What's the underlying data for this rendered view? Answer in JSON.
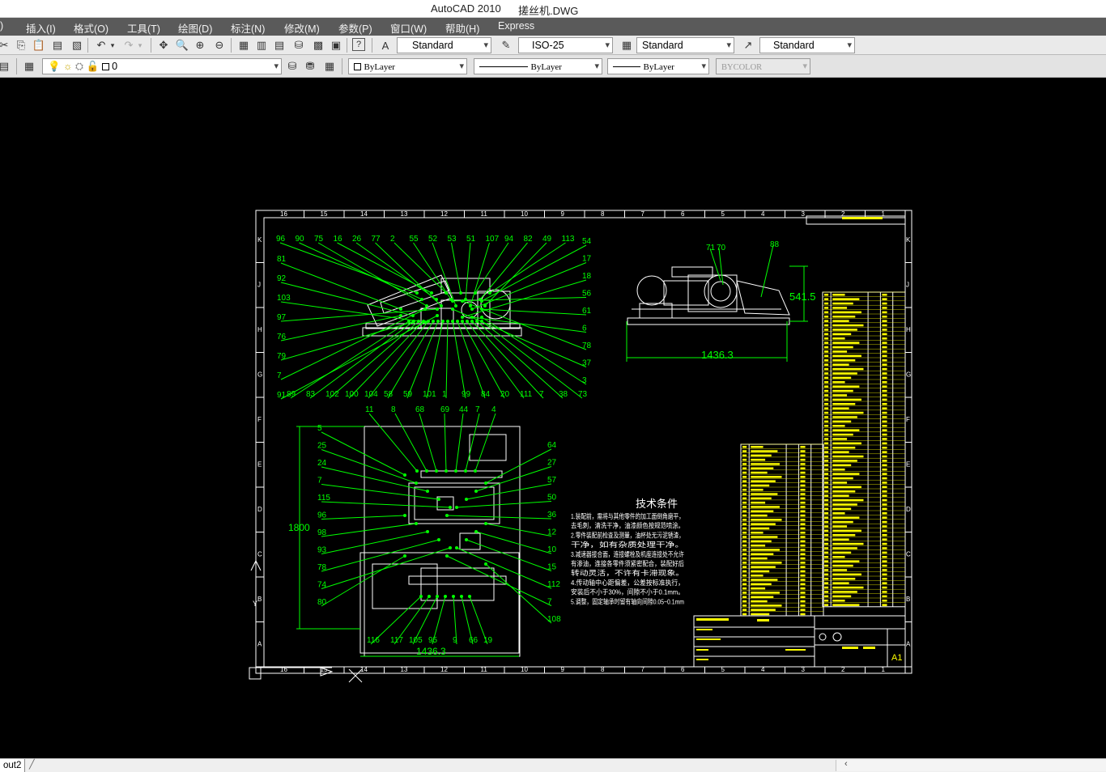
{
  "window": {
    "app_title": "AutoCAD 2010",
    "file_title": "搓丝机.DWG"
  },
  "menu": {
    "items": [
      ")",
      "插入(I)",
      "格式(O)",
      "工具(T)",
      "绘图(D)",
      "标注(N)",
      "修改(M)",
      "参数(P)",
      "窗口(W)",
      "帮助(H)",
      "Express"
    ]
  },
  "toolbar_styles": {
    "text_style": "Standard",
    "dim_style": "ISO-25",
    "table_style": "Standard",
    "mleader_style": "Standard"
  },
  "toolbar_layers": {
    "current_layer": "0",
    "color": "ByLayer",
    "linetype": "ByLayer",
    "lineweight": "ByLayer",
    "plotstyle": "BYCOLOR"
  },
  "status": {
    "layout_tab": "out2"
  },
  "colors": {
    "accent_lines": "#00ff00",
    "table_yellow": "#ffff00",
    "frame_white": "#ffffff",
    "menu_bg": "#5a5a5a"
  },
  "drawing": {
    "balloons_top_left": [
      "96",
      "90",
      "75",
      "16",
      "26",
      "77",
      "2",
      "55",
      "52",
      "53",
      "51",
      "107",
      "94",
      "82",
      "49",
      "113"
    ],
    "balloons_left": [
      "81",
      "92",
      "103",
      "97",
      "76",
      "79",
      "7",
      "91"
    ],
    "balloons_right": [
      "54",
      "17",
      "18",
      "56",
      "61",
      "6",
      "78",
      "37",
      "3"
    ],
    "balloons_bottom": [
      "89",
      "83",
      "102",
      "100",
      "104",
      "58",
      "59",
      "101",
      "1",
      "99",
      "84",
      "20",
      "111",
      "7",
      "38",
      "73"
    ],
    "side_view_labels": [
      "71",
      "70",
      "88"
    ],
    "dim_height_side": "541.5",
    "dim_width_side": "1436.3",
    "plan_labels_top": [
      "11",
      "8",
      "68",
      "69",
      "44",
      "7",
      "4"
    ],
    "plan_labels_left": [
      "5",
      "25",
      "24",
      "7",
      "115",
      "96",
      "98",
      "93",
      "78",
      "74",
      "80"
    ],
    "plan_labels_right": [
      "64",
      "27",
      "57",
      "50",
      "36",
      "12",
      "10",
      "15",
      "112",
      "7",
      "108"
    ],
    "plan_labels_bottom": [
      "116",
      "117",
      "105",
      "95",
      "9",
      "66",
      "19"
    ],
    "dim_height_plan": "1800",
    "dim_width_plan": "1436.3",
    "notes_title": "技术条件",
    "notes_lines": [
      "1.装配前，需将与其他零件的加工面倒角磨平，",
      "去毛刺，清洗干净，油漆颜色按规范喷涂。",
      "2.零件装配前检查及测量，油杯处无污泥锈渣，",
      "干净，如有杂质处理干净。",
      "3.减速器接合面，连接螺栓及机座连接处不允许",
      "有渗油，连接各零件须紧密配合，装配好后",
      "转动灵活，不许有卡滞现象。",
      "4.传动轴中心距偏差，公差按标准执行，",
      "安装后不小于30%，间隙不小于0.1mm。",
      "5.调整，固定轴承时留有轴向间隙0.05~0.1mm"
    ],
    "sheet_size": "A1",
    "frame_zone_numbers_top": [
      "16",
      "15",
      "14",
      "13",
      "12",
      "11",
      "10",
      "9",
      "8",
      "7",
      "6",
      "5",
      "4",
      "3",
      "2",
      "1"
    ],
    "frame_zone_letters": [
      "K",
      "J",
      "H",
      "G",
      "F",
      "E",
      "D",
      "C",
      "B",
      "A"
    ]
  }
}
